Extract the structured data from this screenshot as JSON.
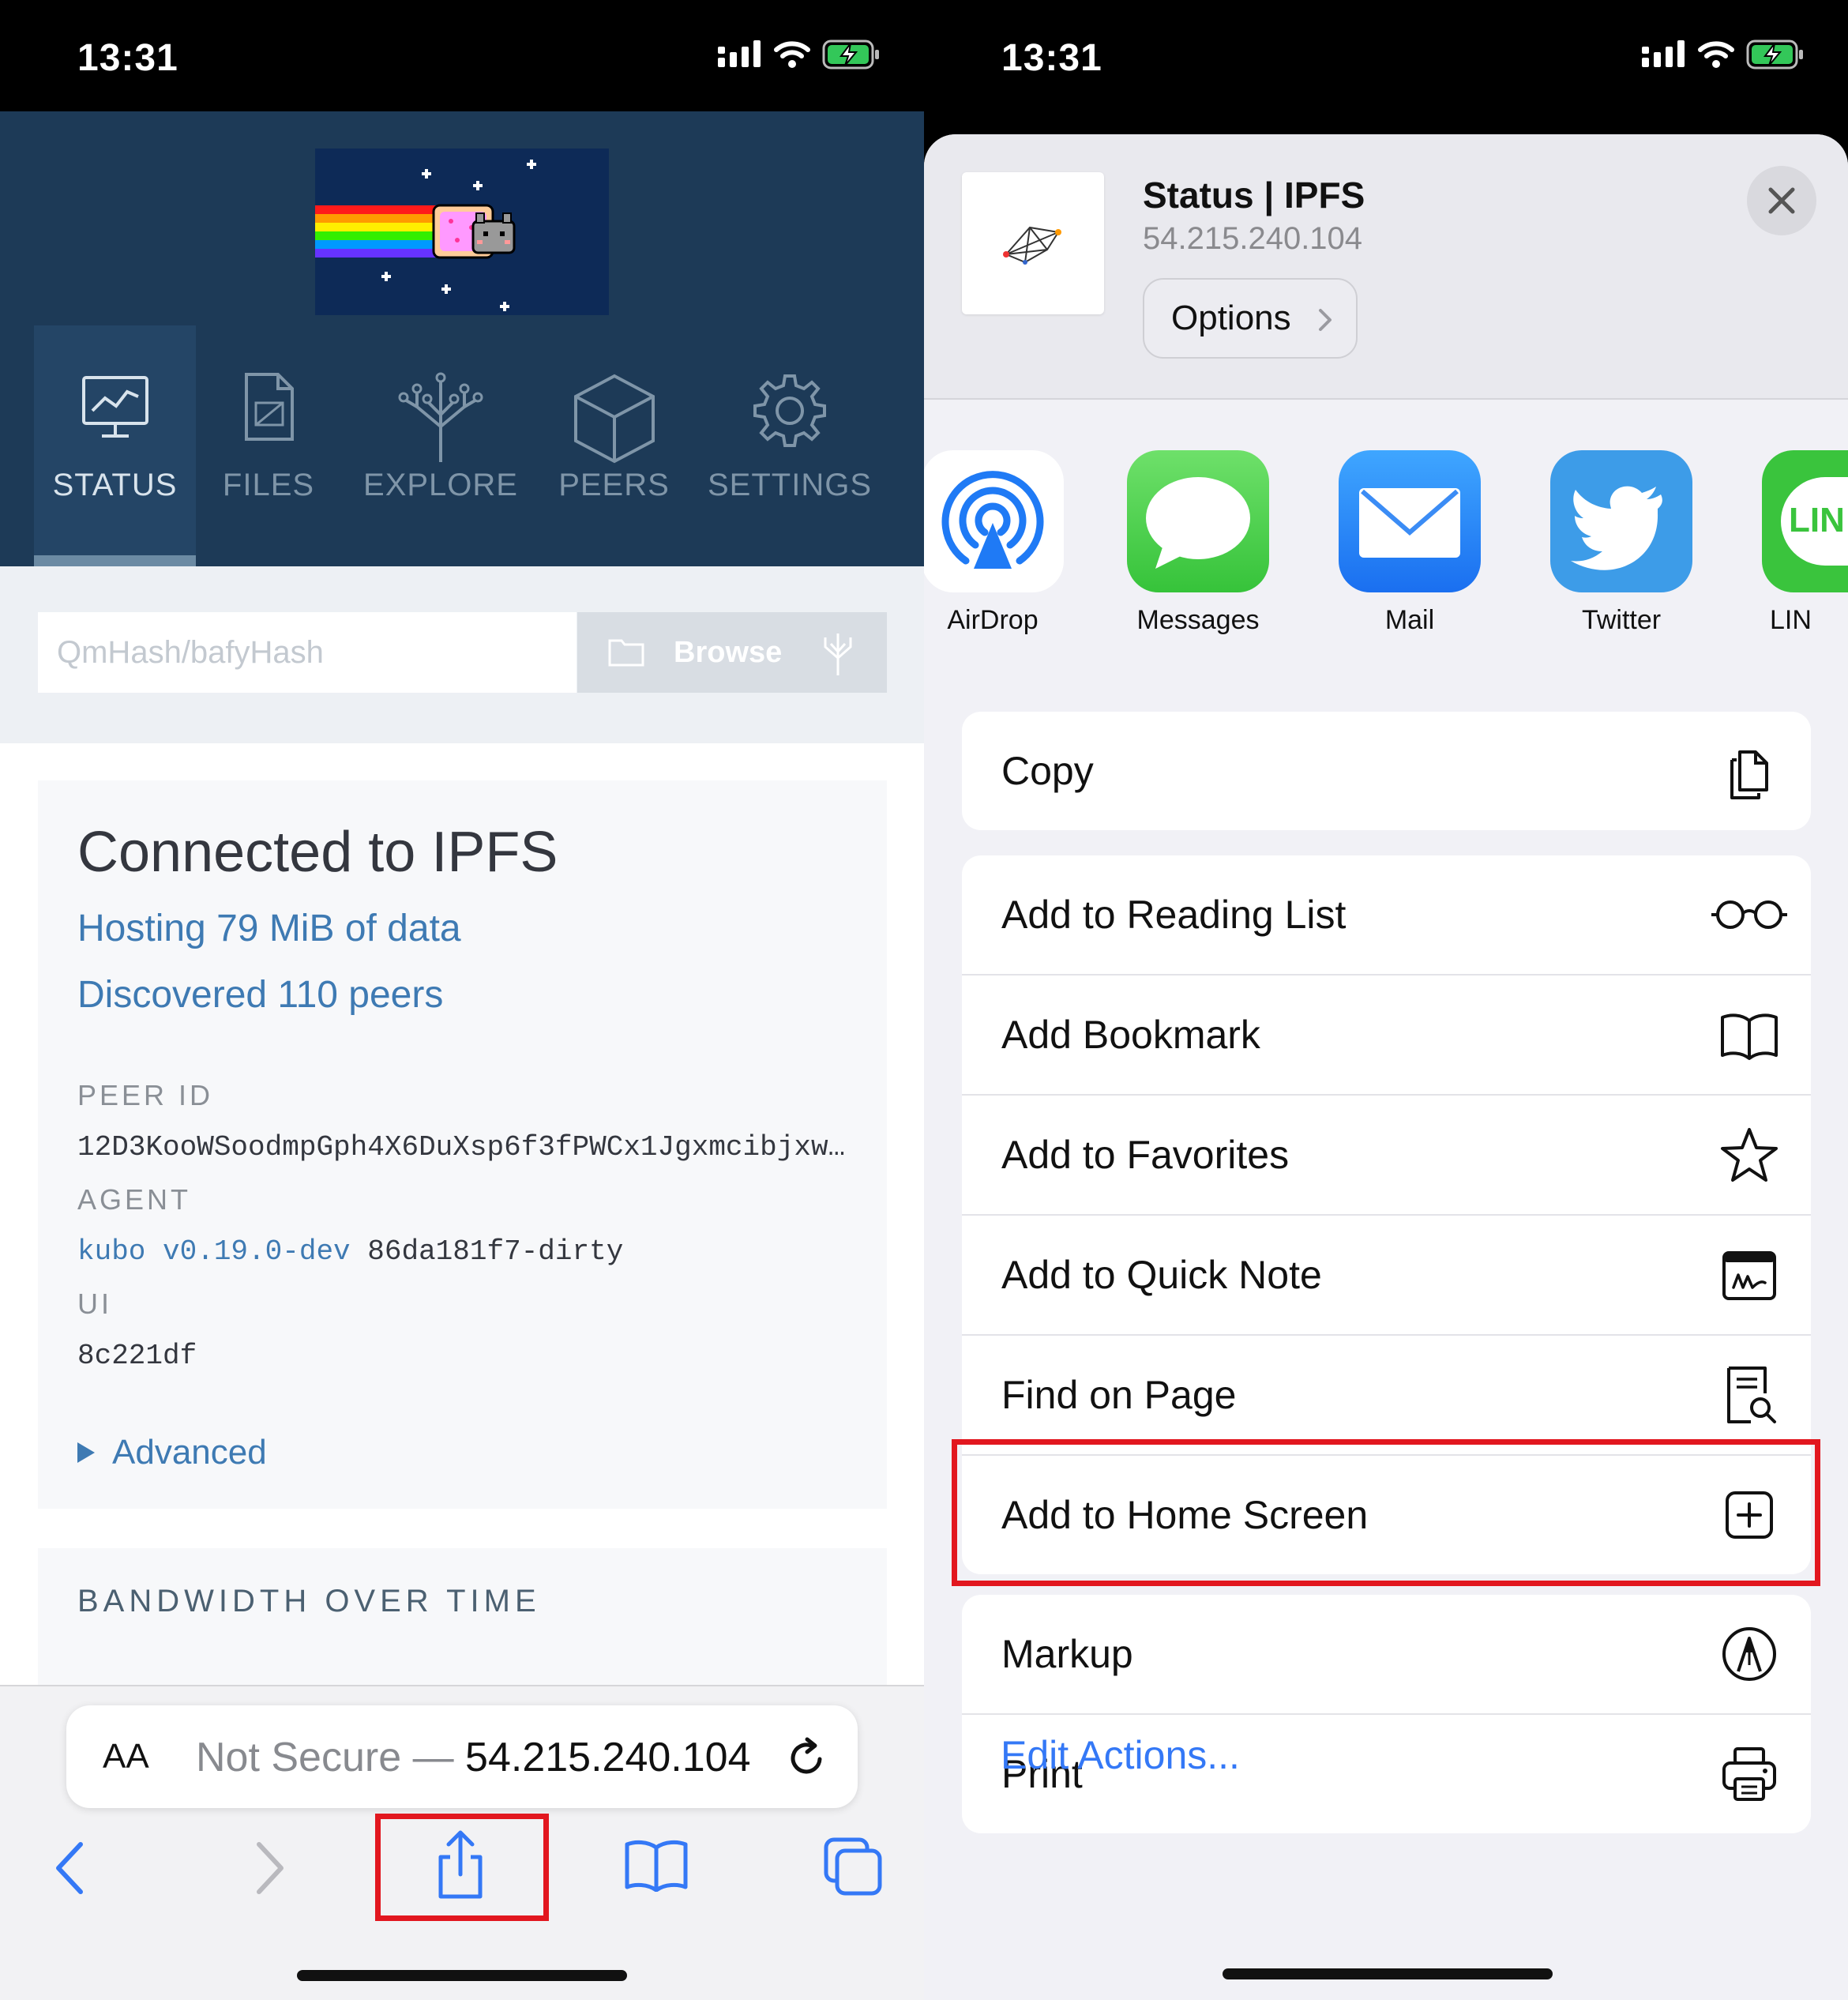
{
  "left": {
    "status_bar": {
      "time": "13:31"
    },
    "nav_tabs": [
      {
        "label": "STATUS",
        "icon": "status-monitor-icon"
      },
      {
        "label": "FILES",
        "icon": "files-icon"
      },
      {
        "label": "EXPLORE",
        "icon": "explore-tree-icon"
      },
      {
        "label": "PEERS",
        "icon": "peers-cube-icon"
      },
      {
        "label": "SETTINGS",
        "icon": "gear-icon"
      }
    ],
    "search": {
      "placeholder": "QmHash/bafyHash",
      "browse_label": "Browse"
    },
    "status": {
      "heading": "Connected to IPFS",
      "hosting": "Hosting 79 MiB of data",
      "peers": "Discovered 110 peers",
      "peer_id_label": "PEER ID",
      "peer_id_value": "12D3KooWSoodmpGph4X6DuXsp6f3fPWCx1Jgxmcibjxw…",
      "agent_label": "AGENT",
      "agent_version": "kubo v0.19.0-dev",
      "agent_commit": "86da181f7-dirty",
      "ui_label": "UI",
      "ui_value": "8c221df",
      "advanced_label": "Advanced"
    },
    "bandwidth": {
      "title": "BANDWIDTH OVER TIME"
    },
    "safari": {
      "aa_label": "AA",
      "not_secure": "Not Secure — ",
      "host": "54.215.240.104"
    }
  },
  "right": {
    "status_bar": {
      "time": "13:31"
    },
    "share_sheet": {
      "title": "Status | IPFS",
      "subtitle": "54.215.240.104",
      "options_label": "Options",
      "apps": [
        {
          "label": "AirDrop",
          "icon": "airdrop-icon"
        },
        {
          "label": "Messages",
          "icon": "messages-icon"
        },
        {
          "label": "Mail",
          "icon": "mail-icon"
        },
        {
          "label": "Twitter",
          "icon": "twitter-icon"
        },
        {
          "label": "LIN",
          "icon": "line-icon",
          "icon_text": "LIN"
        }
      ],
      "actions": {
        "copy": "Copy",
        "reading_list": "Add to Reading List",
        "bookmark": "Add Bookmark",
        "favorites": "Add to Favorites",
        "quick_note": "Add to Quick Note",
        "find_on_page": "Find on Page",
        "home_screen": "Add to Home Screen",
        "markup": "Markup",
        "print": "Print"
      },
      "edit_actions": "Edit Actions..."
    }
  },
  "colors": {
    "ipfs_navy": "#1d3a57",
    "ipfs_link": "#3e7ab3",
    "ios_blue": "#3478f6",
    "highlight_red": "#e2171f"
  }
}
